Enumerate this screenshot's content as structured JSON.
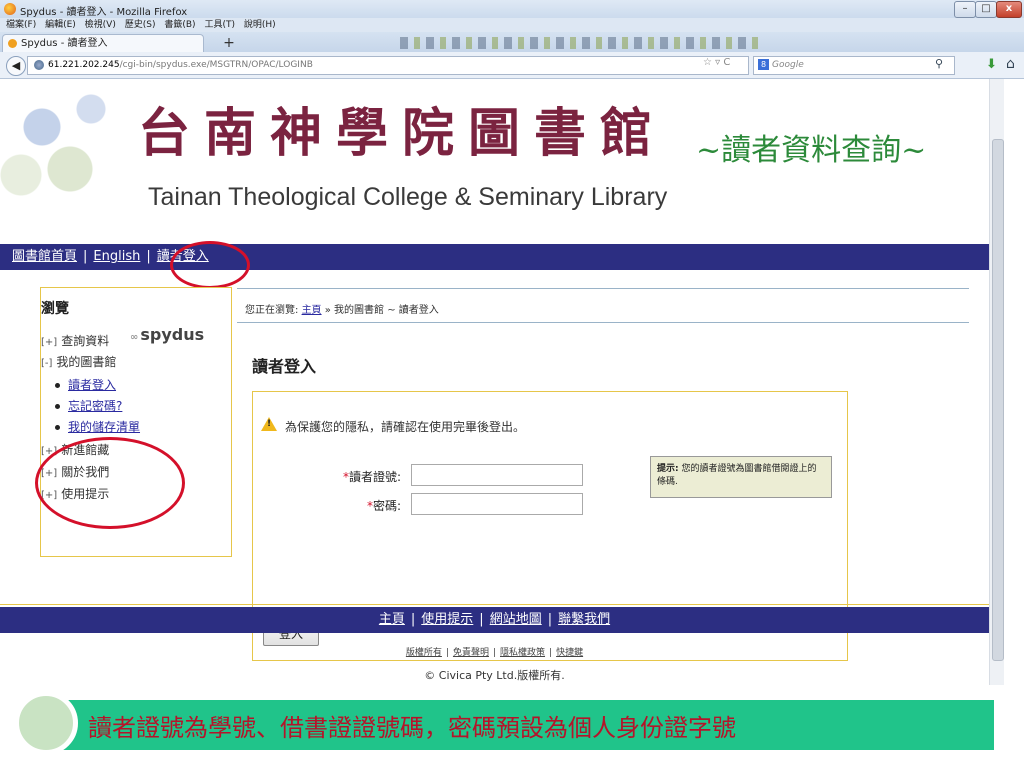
{
  "window": {
    "title": "Spydus - 讀者登入 - Mozilla Firefox",
    "menu": [
      "檔案(F)",
      "編輯(E)",
      "檢視(V)",
      "歷史(S)",
      "書籤(B)",
      "工具(T)",
      "說明(H)"
    ],
    "tab_title": "Spydus - 讀者登入",
    "new_tab": "+",
    "url_host": "61.221.202.245",
    "url_path": "/cgi-bin/spydus.exe/MSGTRN/OPAC/LOGINB",
    "search_placeholder": "Google"
  },
  "banner": {
    "title_zh": "台南神學院圖書館",
    "title_en": "Tainan Theological College & Seminary Library",
    "subtitle": "~讀者資料查詢~"
  },
  "topnav": {
    "items": [
      "圖書館首頁",
      "English",
      "讀者登入"
    ],
    "separator": "|"
  },
  "sidebar": {
    "heading": "瀏覽",
    "items": [
      {
        "marker": "[+]",
        "label": "查詢資料"
      },
      {
        "marker": "[-]",
        "label": "我的圖書館"
      },
      {
        "marker": "[+]",
        "label": "新進館藏"
      },
      {
        "marker": "[+]",
        "label": "關於我們"
      },
      {
        "marker": "[+]",
        "label": "使用提示"
      }
    ],
    "subitems": [
      "讀者登入",
      "忘記密碼?",
      "我的儲存清單"
    ],
    "logo": "spydus"
  },
  "breadcrumb": {
    "prefix": "您正在瀏覽:",
    "home": "主頁",
    "rest": "» 我的圖書館 ~ 讀者登入"
  },
  "login": {
    "heading": "讀者登入",
    "warning": "為保護您的隱私，請確認在使用完畢後登出。",
    "required_mark": "*",
    "card_label": "讀者證號:",
    "password_label": "密碼:",
    "card_value": "",
    "password_value": "",
    "hint_title": "提示:",
    "hint_text": "您的讀者證號為圖書館借閱證上的條碼.",
    "button": "登入"
  },
  "footer": {
    "nav": [
      "主頁",
      "使用提示",
      "網站地圖",
      "聯繫我們"
    ],
    "links": [
      "版權所有",
      "免責聲明",
      "隱私權政策",
      "快捷鍵"
    ],
    "copyright": "© Civica Pty Ltd.版權所有."
  },
  "caption": "讀者證號為學號、借書證證號碼，密碼預設為個人身份證字號",
  "colors": {
    "nav_bg": "#2c2e82",
    "title_zh": "#7b2340",
    "subtitle": "#2c8a3a",
    "highlight_circle": "#d4102a",
    "caption_bg": "#20c48a",
    "caption_text": "#b5142a",
    "box_border": "#e6c64a"
  }
}
